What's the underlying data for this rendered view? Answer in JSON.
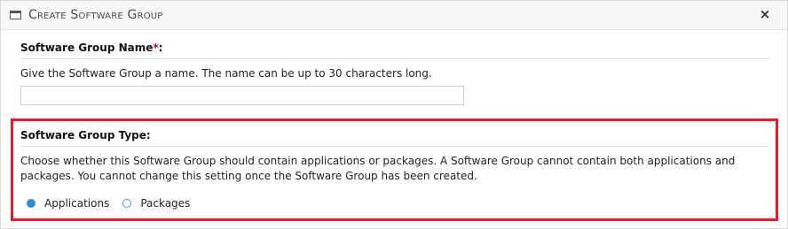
{
  "dialog": {
    "title": "Create Software Group",
    "close_glyph": "×",
    "colors": {
      "highlight_border": "#e41e26",
      "radio_accent": "#2b8ed6",
      "required": "#d0021b"
    }
  },
  "name_section": {
    "label": "Software Group Name",
    "required_marker": "*",
    "label_suffix": ":",
    "description": "Give the Software Group a name. The name can be up to 30 characters long.",
    "input_value": "",
    "input_placeholder": ""
  },
  "type_section": {
    "label": "Software Group Type:",
    "description": "Choose whether this Software Group should contain applications or packages. A Software Group cannot contain both applications and packages. You cannot change this setting once the Software Group has been created.",
    "options": [
      {
        "label": "Applications",
        "selected": true
      },
      {
        "label": "Packages",
        "selected": false
      }
    ]
  }
}
